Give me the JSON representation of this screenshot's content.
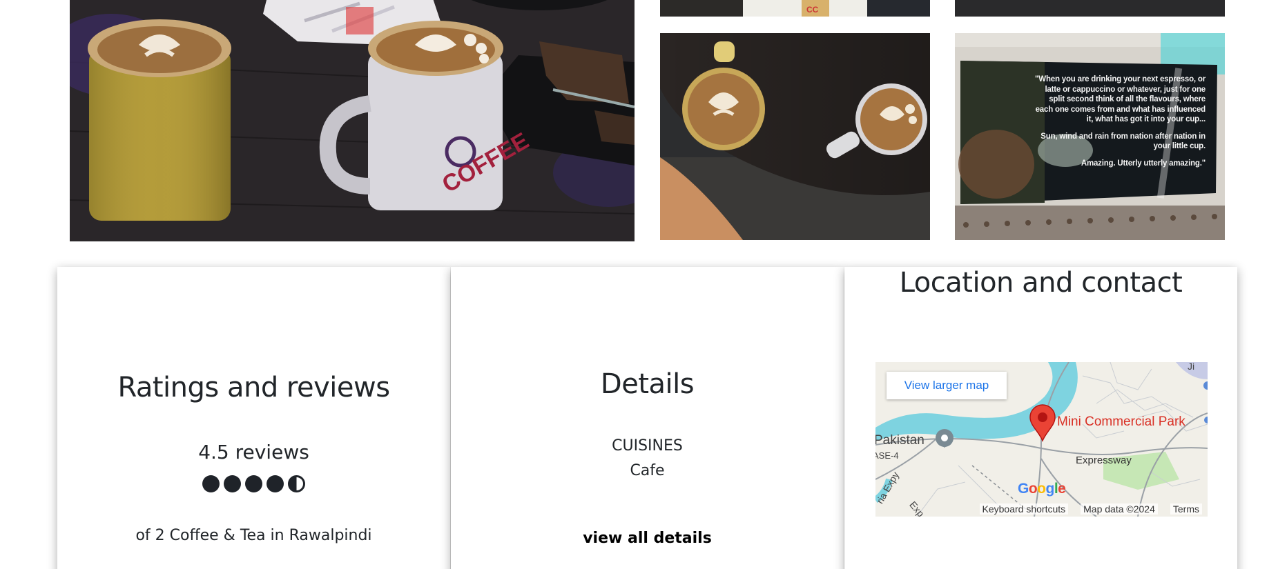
{
  "gallery": {
    "quote_lines": [
      "\"When you are drinking your next espresso, or latte or cappuccino or whatever, just for one split second think of all the flavours, where each one comes from and what has influenced it, what has got it into your cup...",
      "Sun, wind and rain from nation after nation in your little cup.",
      "Amazing. Utterly utterly amazing.\""
    ],
    "mug_text": "COFFEE"
  },
  "ratings": {
    "heading": "Ratings and reviews",
    "summary": "4.5 reviews",
    "rating_value": 4.5,
    "rating_max": 5,
    "rank_text": "of 2 Coffee & Tea in Rawalpindi"
  },
  "details": {
    "heading": "Details",
    "cuisines_label": "CUISINES",
    "cuisines_value": "Cafe",
    "view_all_label": "view all details"
  },
  "location": {
    "heading": "Location and contact",
    "map": {
      "view_larger_label": "View larger map",
      "place_label": "Mini Commercial Park",
      "label_pakistan": "Pakistan",
      "label_se4": "ASE-4",
      "label_expressway": "Expressway",
      "label_ji": "Ji",
      "label_expy": "ria Expy",
      "label_exp2": "Exp",
      "google_logo": "Google",
      "footer_shortcuts": "Keyboard shortcuts",
      "footer_data": "Map data ©2024",
      "footer_terms": "Terms"
    }
  },
  "colors": {
    "text": "#212529",
    "dot": "#1f2329",
    "map_link": "#1a73e8",
    "map_pin": "#ea4335",
    "map_water": "#7ed3e0"
  },
  "icons": {
    "rating_full": "filled-circle-icon",
    "rating_half": "half-circle-icon",
    "map_pin": "map-pin-icon",
    "map_place": "place-marker-icon"
  }
}
